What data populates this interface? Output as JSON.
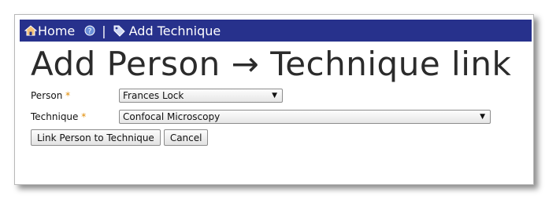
{
  "nav": {
    "home_label": "Home",
    "separator": "|",
    "page_label": "Add Technique"
  },
  "page_title": "Add Person → Technique link",
  "form": {
    "person": {
      "label": "Person",
      "required_marker": "*",
      "value": "Frances Lock"
    },
    "technique": {
      "label": "Technique",
      "required_marker": "*",
      "value": "Confocal Microscopy"
    }
  },
  "buttons": {
    "submit_label": "Link Person to Technique",
    "cancel_label": "Cancel"
  },
  "colors": {
    "navbar": "#27318c",
    "required": "#e08a00"
  }
}
